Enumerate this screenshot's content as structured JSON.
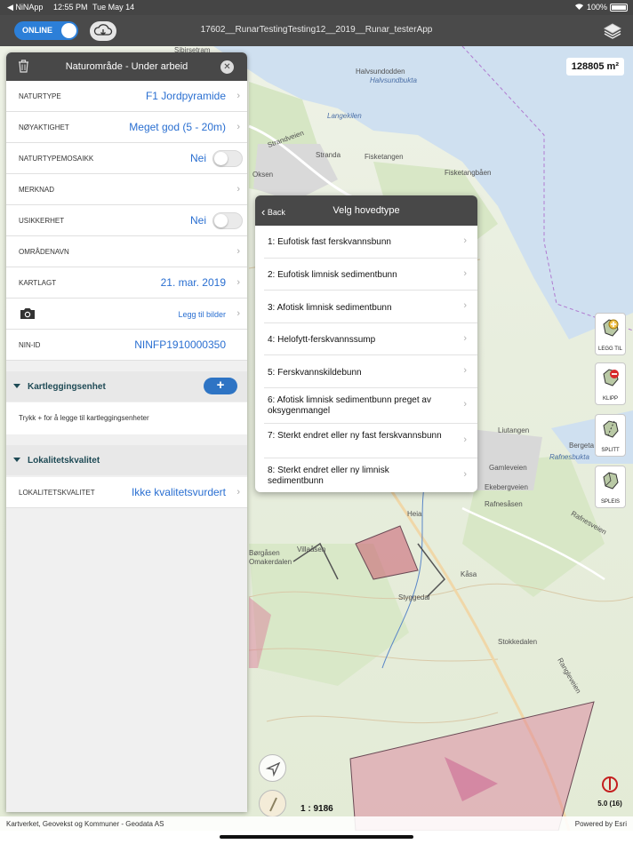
{
  "status_bar": {
    "back_app": "◀ NiNApp",
    "time": "12:55 PM",
    "date": "Tue May 14",
    "battery": "100%"
  },
  "top_bar": {
    "online_label": "ONLINE",
    "title": "17602__RunarTestingTesting12__2019__Runar_testerApp"
  },
  "map": {
    "area": "128805 m²",
    "scale": "1 : 9186",
    "gps_accuracy": "5.0 (16)",
    "attribution": "Kartverket, Geovekst og Kommuner - Geodata AS",
    "powered_by": "Powered by Esri",
    "place_labels": [
      "Halvsundodden",
      "Halvsundbukta",
      "Langekilen",
      "Strandveien",
      "Stranda",
      "Fisketangen",
      "Fisketangbåen",
      "Oksen",
      "Liutangen",
      "Bergeta",
      "Rafnesbukta",
      "Gamleveien",
      "Ekebergveien",
      "Rafnesåsen",
      "Rafnesveien",
      "Heia",
      "Villaåsen",
      "Børgåsen",
      "Omakerdalen",
      "Styggedal",
      "Kåsa",
      "Stokkedalen",
      "Rangleveien",
      "Sibirsetram"
    ],
    "tools": [
      {
        "label": "LEGG TIL",
        "icon": "add-polygon-icon"
      },
      {
        "label": "KLIPP",
        "icon": "clip-polygon-icon"
      },
      {
        "label": "SPLITT",
        "icon": "split-polygon-icon"
      },
      {
        "label": "SPLEIS",
        "icon": "merge-polygon-icon"
      }
    ]
  },
  "panel": {
    "title": "Naturområde - Under arbeid",
    "rows": [
      {
        "key": "NATURTYPE",
        "value": "F1 Jordpyramide"
      },
      {
        "key": "NØYAKTIGHET",
        "value": "Meget god (5 - 20m)"
      },
      {
        "key": "NATURTYPEMOSAIKK",
        "value": "Nei"
      },
      {
        "key": "MERKNAD",
        "value": ""
      },
      {
        "key": "USIKKERHET",
        "value": "Nei"
      },
      {
        "key": "OMRÅDENAVN",
        "value": ""
      },
      {
        "key": "KARTLAGT",
        "value": "21. mar. 2019"
      },
      {
        "key": "",
        "value": "Legg til bilder"
      },
      {
        "key": "NIN-ID",
        "value": "NINFP1910000350"
      }
    ],
    "section1_title": "Kartleggingsenhet",
    "section1_hint": "Trykk + for å legge til kartleggingsenheter",
    "add_label": "+",
    "section2_title": "Lokalitetskvalitet",
    "quality_key": "LOKALITETSKVALITET",
    "quality_value": "Ikke kvalitetsvurdert"
  },
  "popup": {
    "back_label": "Back",
    "title": "Velg hovedtype",
    "options": [
      "1: Eufotisk fast ferskvannsbunn",
      "2: Eufotisk limnisk sedimentbunn",
      "3: Afotisk limnisk sedimentbunn",
      "4: Helofytt-ferskvannssump",
      "5: Ferskvannskildebunn",
      "6: Afotisk limnisk sedimentbunn preget av oksygenmangel",
      "7: Sterkt endret eller ny fast ferskvannsbunn",
      "8: Sterkt endret eller ny limnisk sedimentbunn"
    ]
  }
}
